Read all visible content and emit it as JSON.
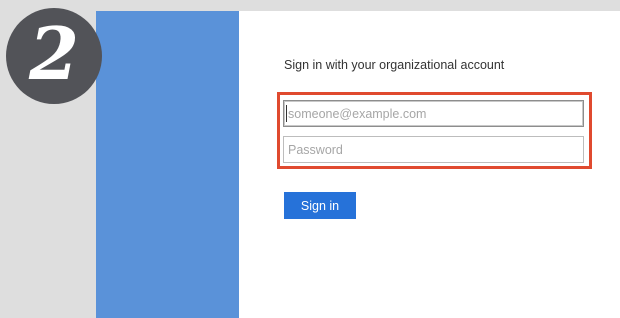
{
  "step": {
    "number": "2"
  },
  "signin": {
    "heading": "Sign in with your organizational account",
    "username_placeholder": "someone@example.com",
    "username_value": "",
    "password_placeholder": "Password",
    "button_label": "Sign in"
  },
  "colors": {
    "page_background": "#dedede",
    "badge": "#525358",
    "left_panel": "#5a92d9",
    "highlight": "#e04a2f",
    "button": "#2672d9"
  }
}
